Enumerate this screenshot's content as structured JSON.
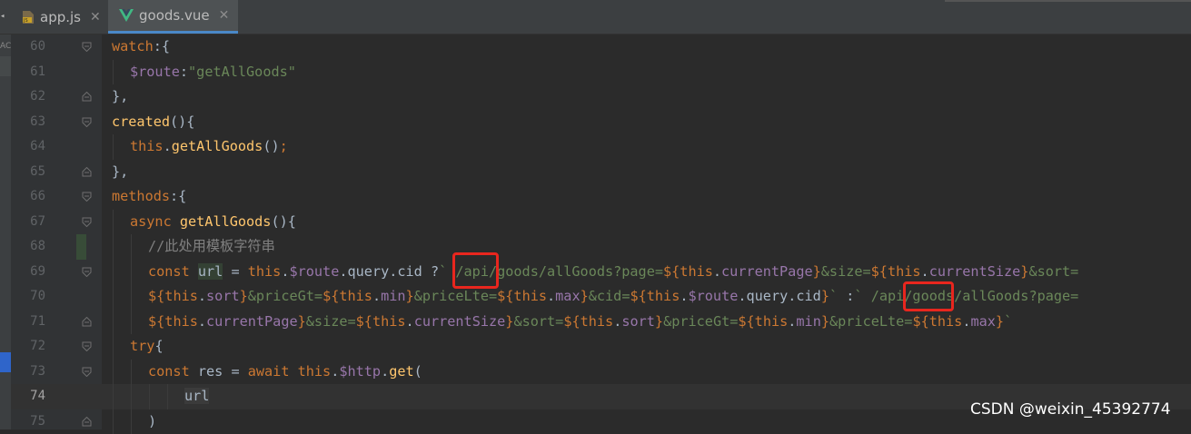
{
  "tabs": [
    {
      "label": "app.js",
      "icon": "js-file-icon",
      "active": false,
      "close": "✕"
    },
    {
      "label": "goods.vue",
      "icon": "vue-file-icon",
      "active": true,
      "close": "✕"
    }
  ],
  "left_strip": {
    "mark": "AC"
  },
  "current_line": 74,
  "lines": [
    {
      "num": "60",
      "fold": "collapse",
      "indent": 0,
      "tokens": [
        [
          "kw",
          "watch"
        ],
        [
          "plain",
          ":{"
        ]
      ]
    },
    {
      "num": "61",
      "fold": "",
      "indent": 1,
      "tokens": [
        [
          "prop",
          "$route"
        ],
        [
          "plain",
          ":"
        ],
        [
          "str",
          "\"getAllGoods\""
        ]
      ]
    },
    {
      "num": "62",
      "fold": "end",
      "indent": 0,
      "tokens": [
        [
          "plain",
          "},"
        ]
      ]
    },
    {
      "num": "63",
      "fold": "collapse",
      "indent": 0,
      "tokens": [
        [
          "fn",
          "created"
        ],
        [
          "plain",
          "(){"
        ]
      ]
    },
    {
      "num": "64",
      "fold": "",
      "indent": 1,
      "tokens": [
        [
          "kw",
          "this"
        ],
        [
          "plain",
          "."
        ],
        [
          "fn",
          "getAllGoods"
        ],
        [
          "plain",
          "()"
        ],
        [
          "kw",
          ";"
        ]
      ]
    },
    {
      "num": "65",
      "fold": "end",
      "indent": 0,
      "tokens": [
        [
          "plain",
          "},"
        ]
      ]
    },
    {
      "num": "66",
      "fold": "collapse",
      "indent": 0,
      "tokens": [
        [
          "kw",
          "methods"
        ],
        [
          "plain",
          ":{"
        ]
      ]
    },
    {
      "num": "67",
      "fold": "collapse",
      "indent": 1,
      "tokens": [
        [
          "kw",
          "async "
        ],
        [
          "fn",
          "getAllGoods"
        ],
        [
          "plain",
          "(){"
        ]
      ]
    },
    {
      "num": "68",
      "fold": "",
      "indent": 2,
      "tokens": [
        [
          "cmt",
          "//此处用模板字符串"
        ]
      ]
    },
    {
      "num": "69",
      "fold": "collapse",
      "indent": 2,
      "tokens": [
        [
          "kw",
          "const "
        ],
        [
          "url",
          "url"
        ],
        [
          "plain",
          " = "
        ],
        [
          "kw",
          "this"
        ],
        [
          "plain",
          "."
        ],
        [
          "prop",
          "$route"
        ],
        [
          "plain",
          ".query.cid "
        ],
        [
          "plain",
          "?"
        ],
        [
          "str",
          "` /api/goods/allGoods?page="
        ],
        [
          "kw",
          "${"
        ],
        [
          "kw",
          "this"
        ],
        [
          "plain",
          "."
        ],
        [
          "prop",
          "currentPage"
        ],
        [
          "kw",
          "}"
        ],
        [
          "str",
          "&size="
        ],
        [
          "kw",
          "${"
        ],
        [
          "kw",
          "this"
        ],
        [
          "plain",
          "."
        ],
        [
          "prop",
          "currentSize"
        ],
        [
          "kw",
          "}"
        ],
        [
          "str",
          "&sort="
        ]
      ]
    },
    {
      "num": "70",
      "fold": "",
      "indent": 2,
      "tokens": [
        [
          "kw",
          "${"
        ],
        [
          "kw",
          "this"
        ],
        [
          "plain",
          "."
        ],
        [
          "prop",
          "sort"
        ],
        [
          "kw",
          "}"
        ],
        [
          "str",
          "&priceGt="
        ],
        [
          "kw",
          "${"
        ],
        [
          "kw",
          "this"
        ],
        [
          "plain",
          "."
        ],
        [
          "prop",
          "min"
        ],
        [
          "kw",
          "}"
        ],
        [
          "str",
          "&priceLte="
        ],
        [
          "kw",
          "${"
        ],
        [
          "kw",
          "this"
        ],
        [
          "plain",
          "."
        ],
        [
          "prop",
          "max"
        ],
        [
          "kw",
          "}"
        ],
        [
          "str",
          "&cid="
        ],
        [
          "kw",
          "${"
        ],
        [
          "kw",
          "this"
        ],
        [
          "plain",
          "."
        ],
        [
          "prop",
          "$route"
        ],
        [
          "plain",
          ".query.cid"
        ],
        [
          "kw",
          "}"
        ],
        [
          "str",
          "` "
        ],
        [
          "plain",
          ":"
        ],
        [
          "str",
          "` /api/goods/allGoods?page="
        ]
      ]
    },
    {
      "num": "71",
      "fold": "end",
      "indent": 2,
      "tokens": [
        [
          "kw",
          "${"
        ],
        [
          "kw",
          "this"
        ],
        [
          "plain",
          "."
        ],
        [
          "prop",
          "currentPage"
        ],
        [
          "kw",
          "}"
        ],
        [
          "str",
          "&size="
        ],
        [
          "kw",
          "${"
        ],
        [
          "kw",
          "this"
        ],
        [
          "plain",
          "."
        ],
        [
          "prop",
          "currentSize"
        ],
        [
          "kw",
          "}"
        ],
        [
          "str",
          "&sort="
        ],
        [
          "kw",
          "${"
        ],
        [
          "kw",
          "this"
        ],
        [
          "plain",
          "."
        ],
        [
          "prop",
          "sort"
        ],
        [
          "kw",
          "}"
        ],
        [
          "str",
          "&priceGt="
        ],
        [
          "kw",
          "${"
        ],
        [
          "kw",
          "this"
        ],
        [
          "plain",
          "."
        ],
        [
          "prop",
          "min"
        ],
        [
          "kw",
          "}"
        ],
        [
          "str",
          "&priceLte="
        ],
        [
          "kw",
          "${"
        ],
        [
          "kw",
          "this"
        ],
        [
          "plain",
          "."
        ],
        [
          "prop",
          "max"
        ],
        [
          "kw",
          "}"
        ],
        [
          "str",
          "`"
        ]
      ]
    },
    {
      "num": "72",
      "fold": "collapse",
      "indent": 1,
      "tokens": [
        [
          "kw",
          "try"
        ],
        [
          "plain",
          "{"
        ]
      ]
    },
    {
      "num": "73",
      "fold": "collapse",
      "indent": 2,
      "tokens": [
        [
          "kw",
          "const "
        ],
        [
          "plain",
          "res = "
        ],
        [
          "kw",
          "await "
        ],
        [
          "kw",
          "this"
        ],
        [
          "plain",
          "."
        ],
        [
          "prop",
          "$http"
        ],
        [
          "plain",
          "."
        ],
        [
          "fn",
          "get"
        ],
        [
          "plain",
          "("
        ]
      ]
    },
    {
      "num": "74",
      "fold": "",
      "indent": 4,
      "tokens": [
        [
          "urlbox",
          "url"
        ]
      ]
    },
    {
      "num": "75",
      "fold": "end",
      "indent": 2,
      "tokens": [
        [
          "plain",
          ")"
        ]
      ]
    }
  ],
  "watermark": "CSDN @weixin_45392774",
  "colors": {
    "background": "#2b2b2b",
    "keyword": "#cc7832",
    "function": "#ffc66d",
    "property": "#9876aa",
    "string": "#6a8759",
    "highlight_box": "#e8261e"
  }
}
